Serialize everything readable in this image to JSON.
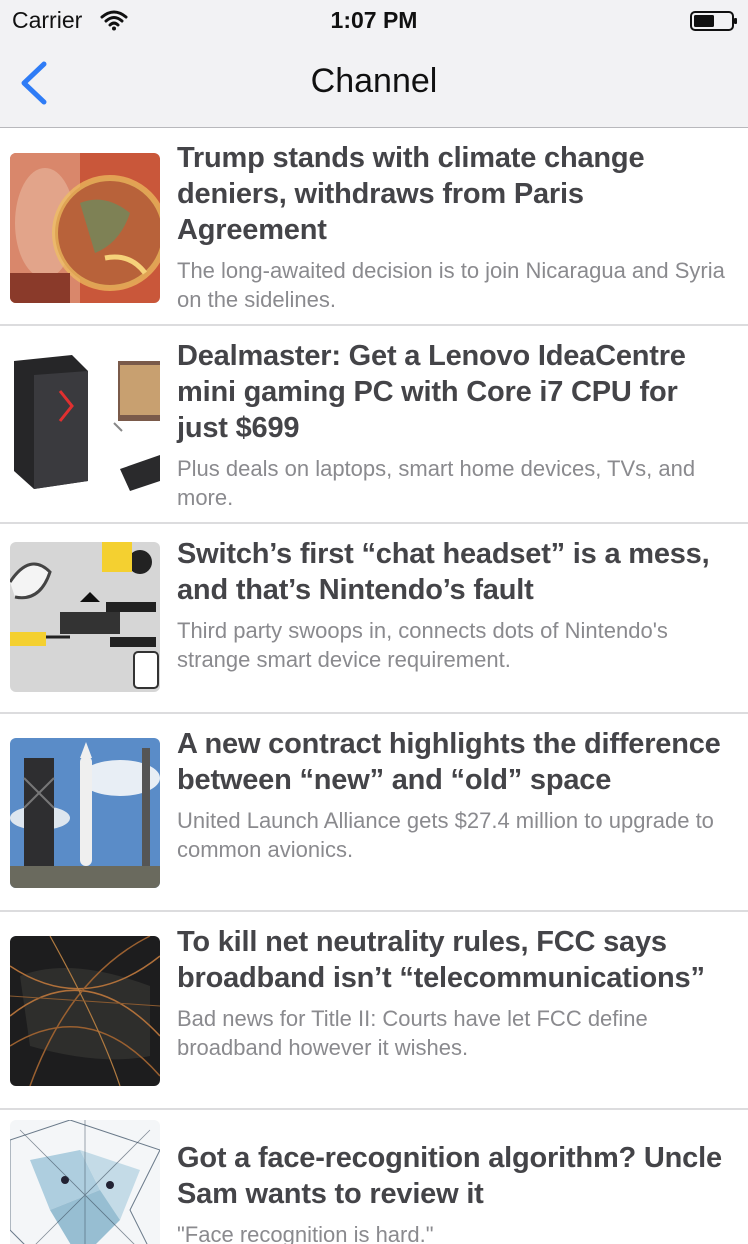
{
  "status": {
    "carrier": "Carrier",
    "time": "1:07 PM"
  },
  "nav": {
    "title": "Channel"
  },
  "colors": {
    "accent": "#2f7cf6",
    "separator": "#dcdcde",
    "bar_background": "#f2f2f4"
  },
  "articles": [
    {
      "headline": "Trump stands with climate change deniers, withdraws from Paris Agreement",
      "summary": "The long-awaited decision is to join Nicaragua and Syria on the sidelines.",
      "thumbnail": "earth-burning-image"
    },
    {
      "headline": "Dealmaster: Get a Lenovo IdeaCentre mini gaming PC with Core i7 CPU for just $699",
      "summary": "Plus deals on laptops, smart home devices, TVs, and more.",
      "thumbnail": "gaming-pc-image"
    },
    {
      "headline": "Switch’s first “chat headset” is a mess, and that’s Nintendo’s fault",
      "summary": "Third party swoops in, connects dots of Nintendo's strange smart device requirement.",
      "thumbnail": "headset-diagram-image"
    },
    {
      "headline": "A new contract highlights the difference between “new” and “old” space",
      "summary": "United Launch Alliance gets $27.4 million to upgrade to common avionics.",
      "thumbnail": "rocket-launch-image"
    },
    {
      "headline": "To kill net neutrality rules, FCC says broadband isn’t “telecommunications”",
      "summary": "Bad news for Title II: Courts have let FCC define broadband however it wishes.",
      "thumbnail": "network-map-image"
    },
    {
      "headline": "Got a face-recognition algorithm? Uncle Sam wants to review it",
      "summary": "\"Face recognition is hard.\"",
      "thumbnail": "face-mesh-image"
    }
  ]
}
